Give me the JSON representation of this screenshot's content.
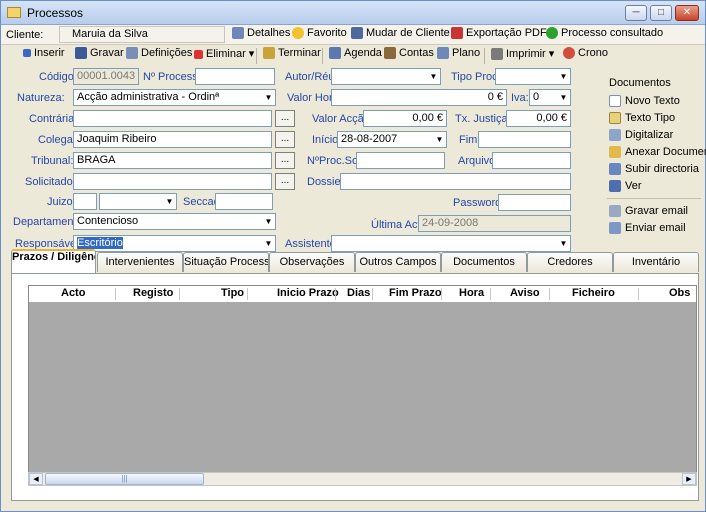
{
  "window": {
    "title": "Processos",
    "minimize": "─",
    "maximize": "□",
    "close": "✕"
  },
  "cliente": {
    "label": "Cliente:",
    "value": "Maruia da Silva",
    "detalhes": "Detalhes",
    "favorito": "Favorito",
    "mudar": "Mudar de Cliente",
    "exportacao": "Exportação PDF",
    "consultado": "Processo consultado"
  },
  "toolbar": {
    "inserir": "Inserir",
    "gravar": "Gravar",
    "definicoes": "Definições",
    "eliminar": "Eliminar",
    "terminar": "Terminar",
    "agenda": "Agenda",
    "contas": "Contas",
    "plano": "Plano",
    "imprimir": "Imprimir",
    "crono": "Crono"
  },
  "form": {
    "codigo_label": "Código:",
    "codigo_value": "00001.0043",
    "nprocesso_label": "Nº Processo:",
    "nprocesso_value": "",
    "autor_label": "Autor/Réu:",
    "autor_value": "",
    "tipoproc_label": "Tipo Proc.:",
    "tipoproc_value": "",
    "natureza_label": "Natureza:",
    "natureza_value": "Acção administrativa - Ordinª",
    "valorhora_label": "Valor Hora:",
    "valorhora_value": "0 €",
    "iva_label": "Iva:",
    "iva_value": "0",
    "contraria_label": "Contrária:",
    "contraria_value": "",
    "valoraccao_label": "Valor Acção:",
    "valoraccao_value": "0,00 €",
    "txjustica_label": "Tx. Justiça:",
    "txjustica_value": "0,00 €",
    "colega_label": "Colega:",
    "colega_value": "Joaquim Ribeiro",
    "inicio_label": "Início:",
    "inicio_value": "28-08-2007",
    "fim_label": "Fim:",
    "fim_value": "",
    "tribunal_label": "Tribunal:",
    "tribunal_value": "BRAGA",
    "nprocsol_label": "NºProc.Sol.:",
    "nprocsol_value": "",
    "arquivo_label": "Arquivo:",
    "arquivo_value": "",
    "solicitador_label": "Solicitador:",
    "solicitador_value": "",
    "dossier_label": "Dossier:",
    "dossier_value": "",
    "juizo_label": "Juizo:",
    "seccao_label": "Seccao:",
    "password_label": "Password:",
    "password_value": "",
    "departamento_label": "Departamento:",
    "departamento_value": "Contencioso",
    "ultimaact_label": "Última Act.:",
    "ultimaact_value": "24-09-2008",
    "responsavel_label": "Responsável:",
    "responsavel_value": "Escritório",
    "assistente_label": "Assistente:",
    "assistente_value": "",
    "dots": "..."
  },
  "side": {
    "title": "Documentos",
    "items": [
      "Novo Texto",
      "Texto Tipo",
      "Digitalizar",
      "Anexar Documento",
      "Subir directoria",
      "Ver"
    ],
    "email": [
      "Gravar email",
      "Enviar email"
    ]
  },
  "tabs": [
    "Prazos / Diligências",
    "Intervenientes",
    "Situação Processual",
    "Observações",
    "Outros Campos",
    "Documentos",
    "Credores",
    "Inventário"
  ],
  "grid": {
    "columns": [
      "Acto",
      "Registo",
      "Tipo",
      "Inicio Prazo",
      "Dias",
      "Fim Prazo",
      "Hora",
      "Aviso",
      "Ficheiro",
      "Obs"
    ]
  },
  "colors": {
    "accent": "#2546a8",
    "tab_highlight": "#f0b03c",
    "grid_bg": "#a9a9a9"
  }
}
